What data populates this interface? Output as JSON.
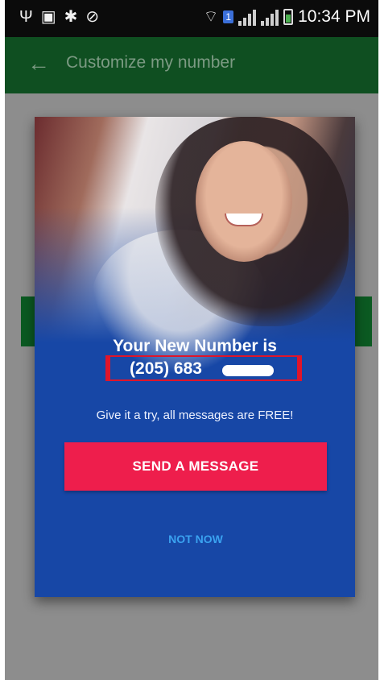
{
  "status_bar": {
    "time": "10:34 PM",
    "sim_badge": "1",
    "left_icons": [
      "usb-icon",
      "image-icon",
      "settings-icon",
      "block-icon"
    ]
  },
  "app_bar": {
    "title": "Customize my number"
  },
  "dialog": {
    "headline": "Your New Number is",
    "number_prefix": "(205) 683",
    "subtext": "Give it a try, all messages are FREE!",
    "send_button": "SEND A MESSAGE",
    "dismiss_button": "NOT NOW"
  },
  "colors": {
    "dialog_background": "#1747a6",
    "send_button": "#ee1e4c",
    "dismiss_text": "#3aa2f0",
    "app_bar": "#0f4f21",
    "highlight_border": "#e0152a"
  }
}
